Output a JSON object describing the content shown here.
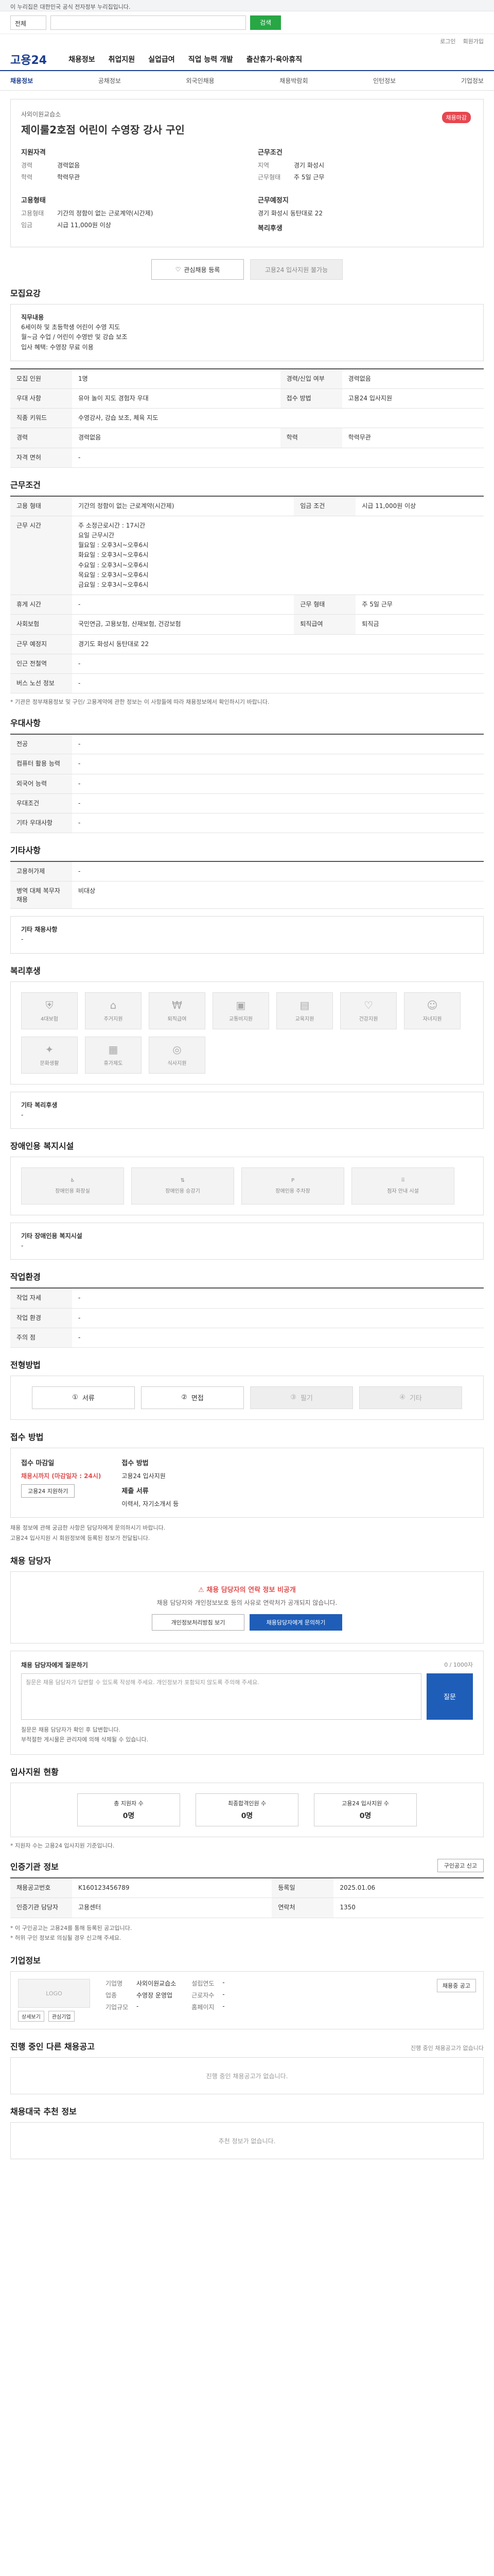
{
  "gov_bar": "이 누리집은 대한민국 공식 전자정부 누리집입니다.",
  "search": {
    "scope": "전체",
    "button": "검색"
  },
  "util": [
    "로그인",
    "회원가입"
  ],
  "logo": "고용24",
  "gnb": [
    "채용정보",
    "취업지원",
    "실업급여",
    "직업 능력 개발",
    "출산휴가·육아휴직"
  ],
  "subnav": [
    "채용정보",
    "공채정보",
    "외국인채용",
    "채용박람회",
    "인턴정보",
    "기업정보"
  ],
  "header": {
    "company": "사외이원교습소",
    "title": "제이룰2호점 어린이 수영장 강사 구인",
    "badge": "채용마감",
    "qual_h": "지원자격",
    "qual": [
      {
        "k": "경력",
        "v": "경력없음"
      },
      {
        "k": "학력",
        "v": "학력무관"
      }
    ],
    "cond_h": "근무조건",
    "cond": [
      {
        "k": "지역",
        "v": "경기 화성시"
      },
      {
        "k": "근무형태",
        "v": "주 5일 근무"
      }
    ],
    "emp_h": "고용형태",
    "emp": [
      {
        "k": "고용형태",
        "v": "기간의 정함이 없는 근로계약(시간제)"
      },
      {
        "k": "임금",
        "v": "시급 11,000원 이상"
      }
    ],
    "loc_h": "근무예정지",
    "loc": "경기 화성시 동탄대로 22",
    "welfare_h": "복리후생",
    "fav_btn": "관심채용 등록",
    "apply_btn": "고용24 입사지원 불가능"
  },
  "s_recruit": {
    "title": "모집요강",
    "job_h": "직무내용",
    "job": [
      "6세이하 및 초등학생 어린이 수영 지도",
      "월~금 수업 / 어린이 수영반 및 강습 보조",
      "입사 혜택: 수영장 무료 이용"
    ],
    "rows": [
      [
        "모집 인원",
        "1명",
        "경력/신입 여부",
        "경력없음"
      ],
      [
        "우대 사항",
        "유아 놀이 지도 경험자 우대",
        "접수 방법",
        "고용24 입사지원"
      ],
      [
        "직종 키워드",
        "수영강사, 강습 보조, 체육 지도",
        "",
        ""
      ],
      [
        "경력",
        "경력없음",
        "학력",
        "학력무관"
      ],
      [
        "자격 면허",
        "-",
        "",
        ""
      ]
    ]
  },
  "s_work": {
    "title": "근무조건",
    "rows": [
      [
        "고용 형태",
        "기간의 정함이 없는 근로계약(시간제)",
        "임금 조건",
        "시급 11,000원 이상"
      ],
      [
        "근무 시간",
        "주 소정근로시간 : 17시간\n요일 근무시간\n월요일 : 오후3시~오후6시\n화요일 : 오후3시~오후6시\n수요일 : 오후3시~오후6시\n목요일 : 오후3시~오후6시\n금요일 : 오후3시~오후6시",
        "",
        ""
      ],
      [
        "휴게 시간",
        "-",
        "근무 형태",
        "주 5일 근무"
      ],
      [
        "사회보험",
        "국민연금, 고용보험, 산재보험, 건강보험",
        "퇴직급여",
        "퇴직금"
      ],
      [
        "근무 예정지",
        "경기도 화성시 동탄대로 22",
        "",
        ""
      ],
      [
        "인근 전철역",
        "-",
        "",
        ""
      ],
      [
        "버스 노선 정보",
        "-",
        "",
        ""
      ]
    ],
    "note": "* 기관은 정부채용정보 및 구인/ 고용계약에 관한 정보는 이 사항들에 따라 채용정보에서 확인하시기 바랍니다."
  },
  "s_pref": {
    "title": "우대사항",
    "rows": [
      [
        "전공",
        "-"
      ],
      [
        "컴퓨터 활용 능력",
        "-"
      ],
      [
        "외국어 능력",
        "-"
      ],
      [
        "우대조건",
        "-"
      ],
      [
        "기타 우대사항",
        "-"
      ]
    ]
  },
  "s_etc": {
    "title": "기타사항",
    "rows": [
      [
        "고용허가제",
        "-"
      ],
      [
        "병역 대체 복무자 채용",
        "비대상"
      ]
    ],
    "extra_h": "기타 채용사항",
    "extra": "-"
  },
  "s_welfare": {
    "title": "복리후생",
    "items": [
      "4대보험",
      "주거지원",
      "퇴직급여",
      "교통비지원",
      "교육지원",
      "건강지원",
      "자녀지원",
      "문화생활",
      "휴가제도",
      "식사지원"
    ],
    "extra_h": "기타 복리후생",
    "extra": "-"
  },
  "s_disability": {
    "title": "장애인용 복지시설",
    "items": [
      "장애인용 화장실",
      "장애인용 승강기",
      "장애인용 주차장",
      "점자 안내 시설"
    ],
    "extra_h": "기타 장애인용 복지시설",
    "extra": "-"
  },
  "s_env": {
    "title": "작업환경",
    "rows": [
      [
        "작업 자세",
        "-",
        "",
        ""
      ],
      [
        "작업 환경",
        "-",
        "",
        ""
      ],
      [
        "주의 점",
        "-",
        "",
        ""
      ]
    ]
  },
  "s_process": {
    "title": "전형방법",
    "steps": [
      "서류",
      "면접",
      "필기",
      "기타"
    ]
  },
  "s_apply": {
    "title": "접수 방법",
    "dl_h": "접수 마감일",
    "dl": "채용시까지 (마감일자 : 24시)",
    "btn": "고용24 지원하기",
    "how_h": "접수 방법",
    "how": "고용24 입사지원",
    "form_h": "제출 서류",
    "form": "이력서, 자기소개서 등",
    "notes": [
      "채용 정보에 관해 궁금한 사항은 담당자에게 문의하시기 바랍니다.",
      "고용24 입사지원 시 회원정보에 등록된 정보가 전달됩니다."
    ]
  },
  "s_contact": {
    "title": "채용 담당자",
    "warn": "채용 담당자의 연락 정보 비공개",
    "desc": "채용 담당자와 개인정보보호 등의 사유로 연락처가 공개되지 않습니다.",
    "b1": "개인정보처리방침 보기",
    "b2": "채용담당자에게 문의하기"
  },
  "s_ask": {
    "label": "채용 담당자에게 질문하기",
    "count": "0 / 1000자",
    "placeholder": "질문은 채용 담당자가 답변할 수 있도록 작성해 주세요. 개인정보가 포함되지 않도록 주의해 주세요.",
    "btn": "질문",
    "notes": [
      "질문은 채용 담당자가 확인 후 답변합니다.",
      "부적절한 게시물은 관리자에 의해 삭제될 수 있습니다."
    ]
  },
  "s_count": {
    "title": "입사지원 현황",
    "items": [
      {
        "l": "총 지원자 수",
        "v": "0명"
      },
      {
        "l": "최종합격인원 수",
        "v": "0명"
      },
      {
        "l": "고용24 입사지원 수",
        "v": "0명"
      }
    ],
    "note": "* 지원자 수는 고용24 입사지원 기준입니다."
  },
  "s_meta": {
    "title": "인증기관 정보",
    "btn": "구인공고 신고",
    "rows": [
      [
        "채용공고번호",
        "K160123456789",
        "등록일",
        "2025.01.06"
      ],
      [
        "인증기관 담당자",
        "고용센터",
        "연락처",
        "1350"
      ]
    ],
    "notes": [
      "* 이 구인공고는 고용24를 통해 등록된 공고입니다.",
      "* 허위 구인 정보로 의심될 경우 신고해 주세요."
    ]
  },
  "s_company": {
    "title": "기업정보",
    "logo": "LOGO",
    "btns": [
      "상세보기",
      "관심기업"
    ],
    "rows": [
      [
        "기업명",
        "사외이원교습소"
      ],
      [
        "업종",
        "수영장 운영업"
      ],
      [
        "기업규모",
        "-"
      ]
    ],
    "right": [
      [
        "설립연도",
        "-"
      ],
      [
        "근로자수",
        "-"
      ],
      [
        "홈페이지",
        "-"
      ]
    ],
    "corp_btn": "채용중 공고"
  },
  "s_other": {
    "title": "진행 중인 다른 채용공고",
    "right": "진행 중인 채용공고가 없습니다",
    "empty": "진행 중인 채용공고가 없습니다."
  },
  "s_bottom": {
    "title": "채용대국 추천 정보",
    "empty": "추천 정보가 없습니다."
  }
}
